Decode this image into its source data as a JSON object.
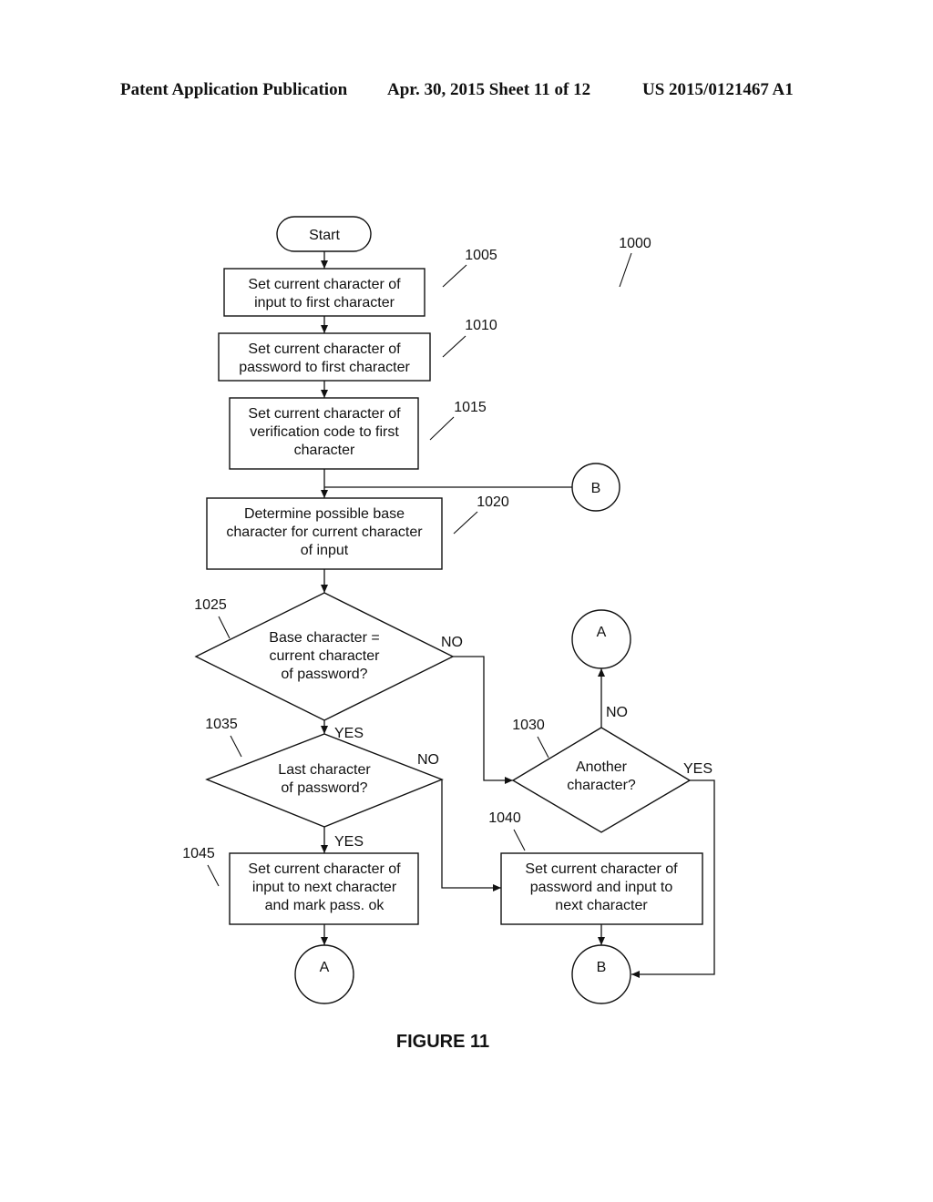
{
  "header": {
    "left": "Patent Application Publication",
    "middle": "Apr. 30, 2015  Sheet 11 of 12",
    "right": "US 2015/0121467 A1"
  },
  "diagram": {
    "figure_ref": "1000",
    "figure_caption": "FIGURE 11",
    "start": "Start",
    "steps": {
      "s1005": {
        "ref": "1005",
        "lines": [
          "Set current character of",
          "input to first character"
        ]
      },
      "s1010": {
        "ref": "1010",
        "lines": [
          "Set current character of",
          "password to first character"
        ]
      },
      "s1015": {
        "ref": "1015",
        "lines": [
          "Set current character of",
          "verification code to first",
          "character"
        ]
      },
      "s1020": {
        "ref": "1020",
        "lines": [
          "Determine possible base",
          "character for current character",
          "of input"
        ]
      },
      "s1025": {
        "ref": "1025",
        "lines": [
          "Base character =",
          "current character",
          "of password?"
        ]
      },
      "s1030": {
        "ref": "1030",
        "lines": [
          "Another",
          "character?"
        ]
      },
      "s1035": {
        "ref": "1035",
        "lines": [
          "Last character",
          "of password?"
        ]
      },
      "s1040": {
        "ref": "1040",
        "lines": [
          "Set current character of",
          "password and input to",
          "next character"
        ]
      },
      "s1045": {
        "ref": "1045",
        "lines": [
          "Set current character of",
          "input to next character",
          "and mark pass. ok"
        ]
      }
    },
    "labels": {
      "d1025_no": "NO",
      "d1025_yes": "YES",
      "d1035_no": "NO",
      "d1035_yes": "YES",
      "d1030_no": "NO",
      "d1030_yes": "YES"
    },
    "connectors": {
      "b_top": "B",
      "a_top": "A",
      "a_bottom": "A",
      "b_bottom": "B"
    }
  }
}
